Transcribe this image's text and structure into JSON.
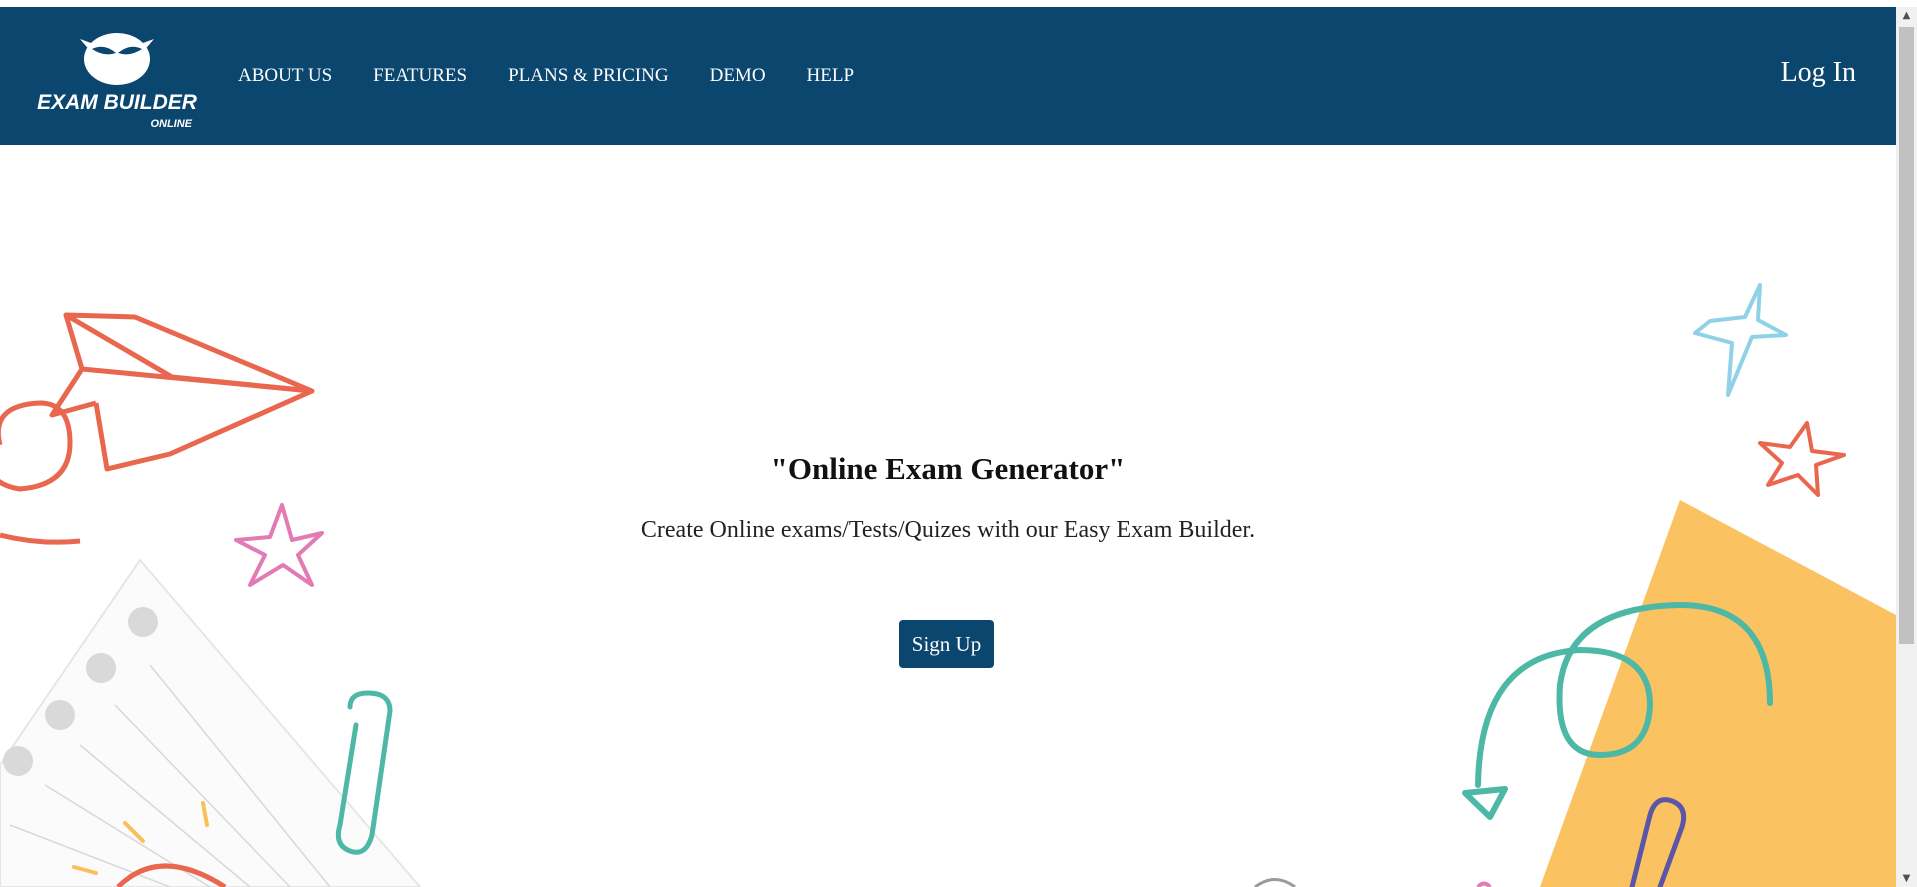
{
  "brand": {
    "name": "EXAM BUILDER",
    "tagline": "ONLINE",
    "colors": {
      "primary": "#0b466f",
      "coral": "#e8674e",
      "teal": "#4db8a5",
      "yellow": "#fbbf5a",
      "sky": "#8fd1e6",
      "pink": "#e27ab4",
      "purple": "#5b56a8"
    }
  },
  "nav": {
    "items": [
      "ABOUT US",
      "FEATURES",
      "PLANS & PRICING",
      "DEMO",
      "HELP"
    ],
    "login": "Log In"
  },
  "hero": {
    "title": "\"Online Exam Generator\"",
    "subtitle": "Create Online exams/Tests/Quizes with our Easy Exam Builder.",
    "cta": "Sign Up"
  },
  "icons": [
    "owl-logo-icon",
    "paper-plane-icon",
    "star-icon",
    "paperclip-icon",
    "notebook-icon",
    "triangle-icon",
    "swirl-arrow-icon"
  ]
}
